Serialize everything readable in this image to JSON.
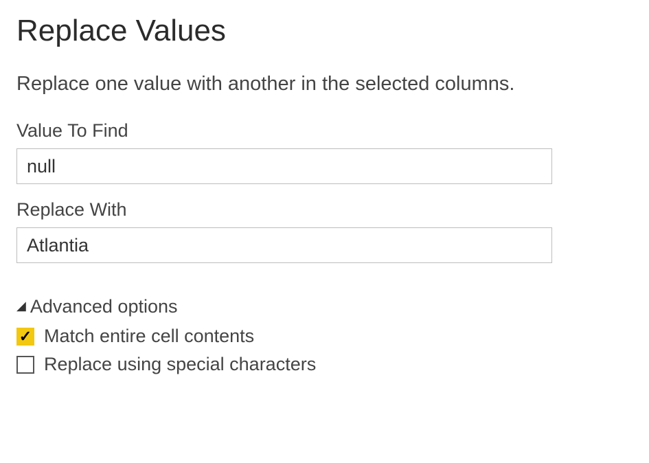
{
  "dialog": {
    "title": "Replace Values",
    "description": "Replace one value with another in the selected columns."
  },
  "fields": {
    "find": {
      "label": "Value To Find",
      "value": "null"
    },
    "replace": {
      "label": "Replace With",
      "value": "Atlantia"
    }
  },
  "advanced": {
    "header": "Advanced options",
    "options": {
      "match_entire": {
        "label": "Match entire cell contents",
        "checked": true
      },
      "special_chars": {
        "label": "Replace using special characters",
        "checked": false
      }
    }
  }
}
